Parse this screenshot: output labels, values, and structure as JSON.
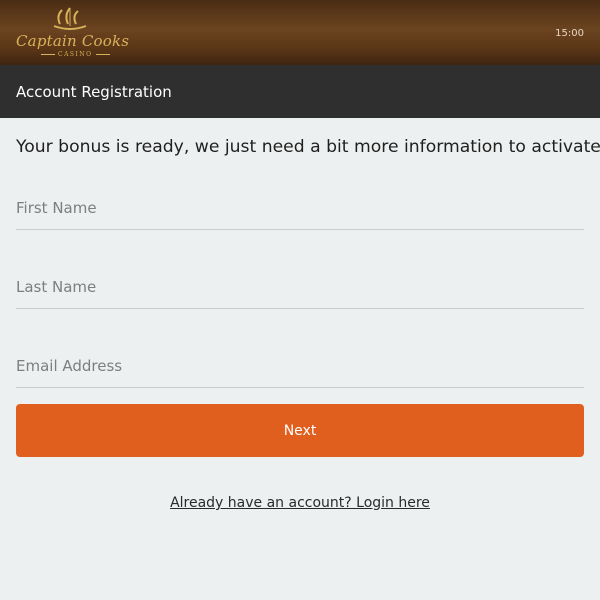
{
  "header": {
    "logo_title": "Captain Cooks",
    "logo_subtitle": "CASINO",
    "logo_icon": "ship-icon",
    "time": "15:00"
  },
  "titlebar": {
    "title": "Account Registration"
  },
  "form": {
    "intro": "Your bonus is ready, we just need a bit more information to activate it",
    "first_name": {
      "placeholder": "First Name",
      "value": ""
    },
    "last_name": {
      "placeholder": "Last Name",
      "value": ""
    },
    "email": {
      "placeholder": "Email Address",
      "value": ""
    },
    "next_label": "Next",
    "login_link": "Already have an account? Login here"
  },
  "colors": {
    "header_brown": "#5a3617",
    "titlebar": "#2f2f2f",
    "accent": "#e05f1f",
    "background": "#edf0f0",
    "logo_gold": "#d8b25a"
  }
}
